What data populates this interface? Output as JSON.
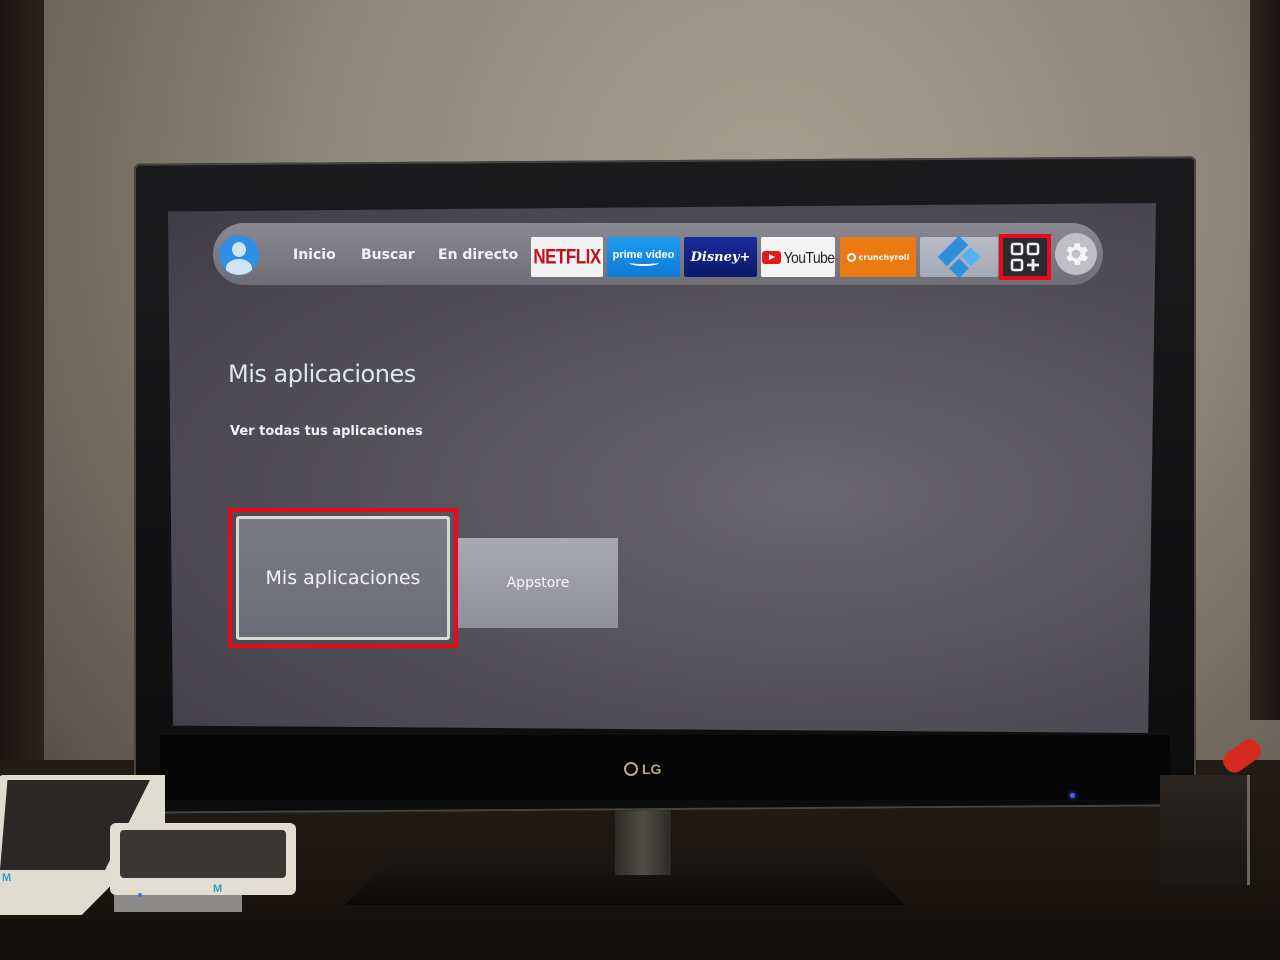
{
  "nav": {
    "avatar_icon": "user-avatar-icon",
    "links": [
      {
        "label": "Inicio"
      },
      {
        "label": "Buscar"
      },
      {
        "label": "En directo"
      }
    ],
    "apps": [
      {
        "name": "Netflix",
        "label": "NETFLIX"
      },
      {
        "name": "Prime Video",
        "label": "prime video"
      },
      {
        "name": "Disney+",
        "label": "Disney+"
      },
      {
        "name": "YouTube",
        "label": "YouTube"
      },
      {
        "name": "Crunchyroll",
        "label": "crunchyroll"
      },
      {
        "name": "Kodi",
        "label": ""
      }
    ],
    "app_grid_icon": "apps-grid-plus-icon",
    "settings_icon": "gear-icon",
    "highlight_color": "#e8091a"
  },
  "section": {
    "title": "Mis aplicaciones",
    "subtitle": "Ver todas tus aplicaciones",
    "cards": [
      {
        "label": "Mis aplicaciones",
        "focused": true
      },
      {
        "label": "Appstore",
        "focused": false
      }
    ]
  },
  "tv": {
    "brand": "LG"
  },
  "devices": {
    "router_logo": "M"
  }
}
